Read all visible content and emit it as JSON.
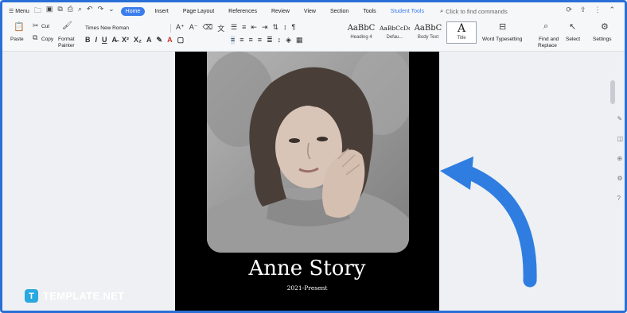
{
  "menubar": {
    "menu_label": "Menu",
    "tabs": [
      {
        "label": "Home",
        "active": true
      },
      {
        "label": "Insert"
      },
      {
        "label": "Page Layout"
      },
      {
        "label": "References"
      },
      {
        "label": "Review"
      },
      {
        "label": "View"
      },
      {
        "label": "Section"
      },
      {
        "label": "Tools"
      },
      {
        "label": "Student Tools",
        "special": true
      }
    ],
    "search_placeholder": "Click to find commands"
  },
  "ribbon": {
    "paste": "Paste",
    "cut": "Cut",
    "copy": "Copy",
    "format_painter_1": "Format",
    "format_painter_2": "Painter",
    "font_name": "Times New Roman",
    "styles": [
      {
        "preview": "AaBbC",
        "caption": "Heading 4"
      },
      {
        "preview": "AaBbCcDd",
        "caption": "Defau..."
      },
      {
        "preview": "AaBbC",
        "caption": "Body Text"
      },
      {
        "preview": "A",
        "caption": "Title",
        "selected": true
      }
    ],
    "word_typesetting": "Word Typesetting",
    "find_replace_1": "Find and",
    "find_replace_2": "Replace",
    "select": "Select",
    "settings": "Settings"
  },
  "document": {
    "name": "Anne Story",
    "years": "2021-Present"
  },
  "brand": {
    "logo_letter": "T",
    "logo_text": "TEMPLATE.NET"
  },
  "colors": {
    "accent": "#3b7ded",
    "frame": "#2a6fd6",
    "arrow": "#2f7de1",
    "logo": "#2aa8e0"
  }
}
